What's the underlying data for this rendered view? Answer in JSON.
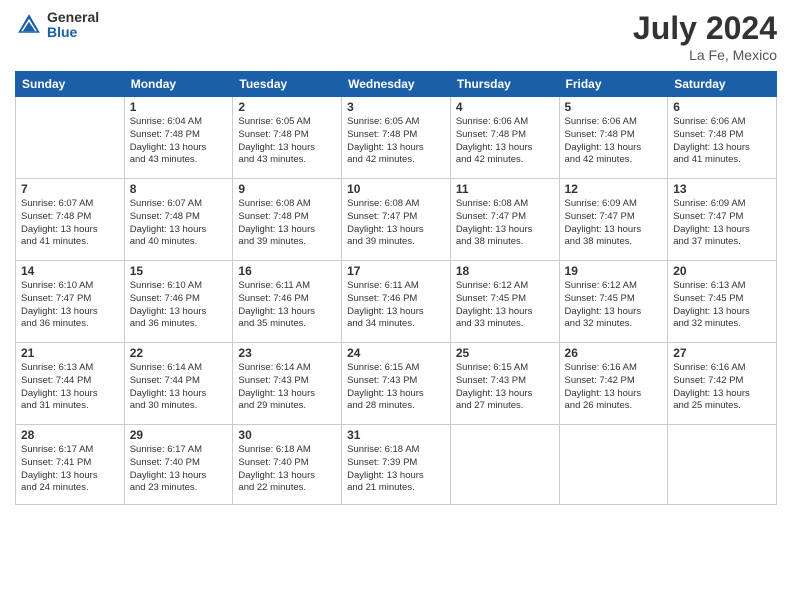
{
  "header": {
    "logo_general": "General",
    "logo_blue": "Blue",
    "month_year": "July 2024",
    "location": "La Fe, Mexico"
  },
  "days_of_week": [
    "Sunday",
    "Monday",
    "Tuesday",
    "Wednesday",
    "Thursday",
    "Friday",
    "Saturday"
  ],
  "weeks": [
    [
      {
        "day": "",
        "info": ""
      },
      {
        "day": "1",
        "info": "Sunrise: 6:04 AM\nSunset: 7:48 PM\nDaylight: 13 hours\nand 43 minutes."
      },
      {
        "day": "2",
        "info": "Sunrise: 6:05 AM\nSunset: 7:48 PM\nDaylight: 13 hours\nand 43 minutes."
      },
      {
        "day": "3",
        "info": "Sunrise: 6:05 AM\nSunset: 7:48 PM\nDaylight: 13 hours\nand 42 minutes."
      },
      {
        "day": "4",
        "info": "Sunrise: 6:06 AM\nSunset: 7:48 PM\nDaylight: 13 hours\nand 42 minutes."
      },
      {
        "day": "5",
        "info": "Sunrise: 6:06 AM\nSunset: 7:48 PM\nDaylight: 13 hours\nand 42 minutes."
      },
      {
        "day": "6",
        "info": "Sunrise: 6:06 AM\nSunset: 7:48 PM\nDaylight: 13 hours\nand 41 minutes."
      }
    ],
    [
      {
        "day": "7",
        "info": "Sunrise: 6:07 AM\nSunset: 7:48 PM\nDaylight: 13 hours\nand 41 minutes."
      },
      {
        "day": "8",
        "info": "Sunrise: 6:07 AM\nSunset: 7:48 PM\nDaylight: 13 hours\nand 40 minutes."
      },
      {
        "day": "9",
        "info": "Sunrise: 6:08 AM\nSunset: 7:48 PM\nDaylight: 13 hours\nand 39 minutes."
      },
      {
        "day": "10",
        "info": "Sunrise: 6:08 AM\nSunset: 7:47 PM\nDaylight: 13 hours\nand 39 minutes."
      },
      {
        "day": "11",
        "info": "Sunrise: 6:08 AM\nSunset: 7:47 PM\nDaylight: 13 hours\nand 38 minutes."
      },
      {
        "day": "12",
        "info": "Sunrise: 6:09 AM\nSunset: 7:47 PM\nDaylight: 13 hours\nand 38 minutes."
      },
      {
        "day": "13",
        "info": "Sunrise: 6:09 AM\nSunset: 7:47 PM\nDaylight: 13 hours\nand 37 minutes."
      }
    ],
    [
      {
        "day": "14",
        "info": "Sunrise: 6:10 AM\nSunset: 7:47 PM\nDaylight: 13 hours\nand 36 minutes."
      },
      {
        "day": "15",
        "info": "Sunrise: 6:10 AM\nSunset: 7:46 PM\nDaylight: 13 hours\nand 36 minutes."
      },
      {
        "day": "16",
        "info": "Sunrise: 6:11 AM\nSunset: 7:46 PM\nDaylight: 13 hours\nand 35 minutes."
      },
      {
        "day": "17",
        "info": "Sunrise: 6:11 AM\nSunset: 7:46 PM\nDaylight: 13 hours\nand 34 minutes."
      },
      {
        "day": "18",
        "info": "Sunrise: 6:12 AM\nSunset: 7:45 PM\nDaylight: 13 hours\nand 33 minutes."
      },
      {
        "day": "19",
        "info": "Sunrise: 6:12 AM\nSunset: 7:45 PM\nDaylight: 13 hours\nand 32 minutes."
      },
      {
        "day": "20",
        "info": "Sunrise: 6:13 AM\nSunset: 7:45 PM\nDaylight: 13 hours\nand 32 minutes."
      }
    ],
    [
      {
        "day": "21",
        "info": "Sunrise: 6:13 AM\nSunset: 7:44 PM\nDaylight: 13 hours\nand 31 minutes."
      },
      {
        "day": "22",
        "info": "Sunrise: 6:14 AM\nSunset: 7:44 PM\nDaylight: 13 hours\nand 30 minutes."
      },
      {
        "day": "23",
        "info": "Sunrise: 6:14 AM\nSunset: 7:43 PM\nDaylight: 13 hours\nand 29 minutes."
      },
      {
        "day": "24",
        "info": "Sunrise: 6:15 AM\nSunset: 7:43 PM\nDaylight: 13 hours\nand 28 minutes."
      },
      {
        "day": "25",
        "info": "Sunrise: 6:15 AM\nSunset: 7:43 PM\nDaylight: 13 hours\nand 27 minutes."
      },
      {
        "day": "26",
        "info": "Sunrise: 6:16 AM\nSunset: 7:42 PM\nDaylight: 13 hours\nand 26 minutes."
      },
      {
        "day": "27",
        "info": "Sunrise: 6:16 AM\nSunset: 7:42 PM\nDaylight: 13 hours\nand 25 minutes."
      }
    ],
    [
      {
        "day": "28",
        "info": "Sunrise: 6:17 AM\nSunset: 7:41 PM\nDaylight: 13 hours\nand 24 minutes."
      },
      {
        "day": "29",
        "info": "Sunrise: 6:17 AM\nSunset: 7:40 PM\nDaylight: 13 hours\nand 23 minutes."
      },
      {
        "day": "30",
        "info": "Sunrise: 6:18 AM\nSunset: 7:40 PM\nDaylight: 13 hours\nand 22 minutes."
      },
      {
        "day": "31",
        "info": "Sunrise: 6:18 AM\nSunset: 7:39 PM\nDaylight: 13 hours\nand 21 minutes."
      },
      {
        "day": "",
        "info": ""
      },
      {
        "day": "",
        "info": ""
      },
      {
        "day": "",
        "info": ""
      }
    ]
  ]
}
